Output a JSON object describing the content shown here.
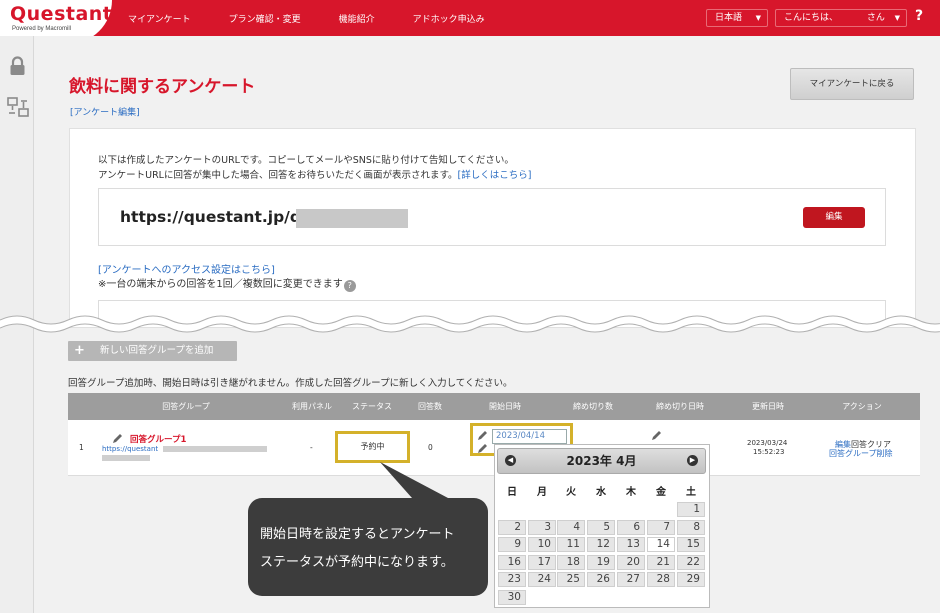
{
  "header": {
    "logo": "Questant",
    "logo_sub": "Powered by Macromill",
    "nav": [
      "マイアンケート",
      "プラン確認・変更",
      "機能紹介",
      "アドホック申込み"
    ],
    "language": "日本語",
    "greeting": "こんにちは、",
    "user_suffix": "さん",
    "help": "?"
  },
  "page": {
    "title": "飲料に関するアンケート",
    "edit_link": "[アンケート編集]",
    "back_button": "マイアンケートに戻る"
  },
  "card": {
    "line1": "以下は作成したアンケートのURLです。コピーしてメールやSNSに貼り付けて告知してください。",
    "line2": "アンケートURLに回答が集中した場合、回答をお待ちいただく画面が表示されます。",
    "detail_link": "[詳しくはこちら]",
    "url": "https://questant.jp/q/",
    "edit_button": "編集",
    "access_link": "[アンケートへのアクセス設定はこちら]",
    "note": "※一台の端末からの回答を1回／複数回に変更できます",
    "note_badge": "?"
  },
  "groups": {
    "add_button": "新しい回答グループを追加",
    "add_plus": "+",
    "note": "回答グループ追加時、開始日時は引き継がれません。作成した回答グループに新しく入力してください。",
    "columns": [
      "回答グループ",
      "利用パネル",
      "ステータス",
      "回答数",
      "開始日時",
      "締め切り数",
      "締め切り日時",
      "更新日時",
      "アクション"
    ],
    "row": {
      "index": "1",
      "name": "回答グループ1",
      "url": "https://questant",
      "panel": "-",
      "status": "予約中",
      "count": "0",
      "start_date": "2023/04/14",
      "updated_date": "2023/03/24",
      "updated_time": "15:52:23",
      "action_edit": "編集",
      "action_clear": "回答クリア",
      "action_delete": "回答グループ削除"
    }
  },
  "calendar": {
    "title": "2023年 4月",
    "prev": "◀",
    "next": "▶",
    "weekdays": [
      "日",
      "月",
      "火",
      "水",
      "木",
      "金",
      "土"
    ],
    "weeks": [
      [
        "",
        "",
        "",
        "",
        "",
        "",
        "1"
      ],
      [
        "2",
        "3",
        "4",
        "5",
        "6",
        "7",
        "8"
      ],
      [
        "9",
        "10",
        "11",
        "12",
        "13",
        "14",
        "15"
      ],
      [
        "16",
        "17",
        "18",
        "19",
        "20",
        "21",
        "22"
      ],
      [
        "23",
        "24",
        "25",
        "26",
        "27",
        "28",
        "29"
      ],
      [
        "30",
        "",
        "",
        "",
        "",
        "",
        ""
      ]
    ],
    "today": "14"
  },
  "tooltip": {
    "line1": "開始日時を設定するとアンケート",
    "line2": "ステータスが予約中になります。"
  },
  "colors": {
    "brand_red": "#d7162b",
    "highlight": "#d4b12a",
    "link": "#2a6cc2"
  }
}
